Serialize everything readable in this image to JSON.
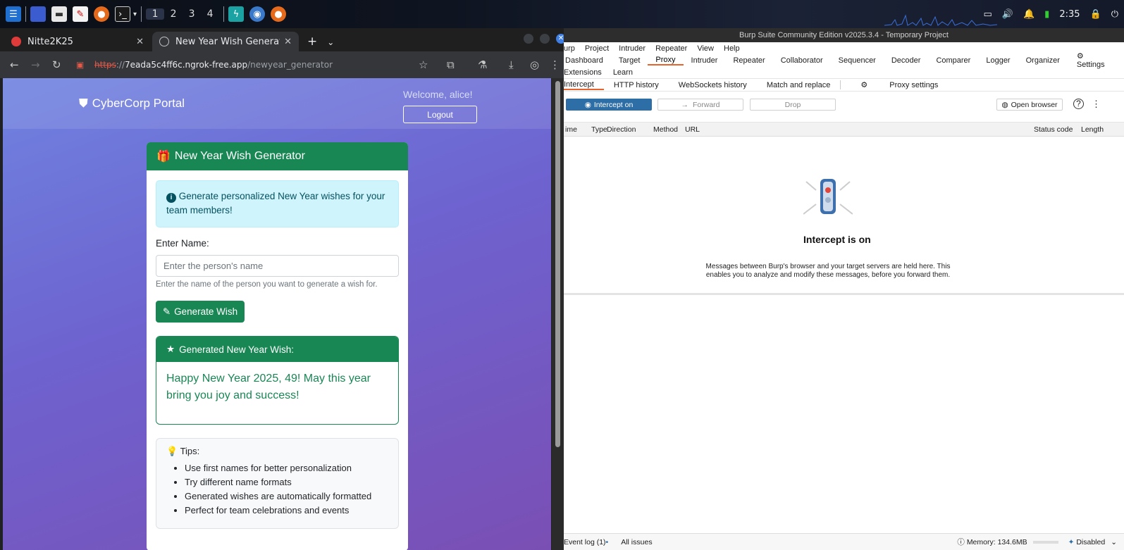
{
  "taskbar": {
    "workspaces": [
      "1",
      "2",
      "3",
      "4"
    ],
    "clock": "2:35"
  },
  "browser": {
    "tabs": [
      {
        "title": "Nitte2K25"
      },
      {
        "title": "New Year Wish Generator"
      }
    ],
    "url_scheme": "https",
    "url_host": "7eada5c4ff6c.ngrok-free.app",
    "url_path": "/newyear_generator"
  },
  "page": {
    "brand": "CyberCorp Portal",
    "welcome": "Welcome, alice!",
    "logout_label": "Logout",
    "card_title": "New Year Wish Generator",
    "info_text": "Generate personalized New Year wishes for your team members!",
    "name_label": "Enter Name:",
    "name_placeholder": "Enter the person's name",
    "help_text": "Enter the name of the person you want to generate a wish for.",
    "generate_label": "Generate Wish",
    "result_title": "Generated New Year Wish:",
    "result_text": "Happy New Year 2025, 49! May this year bring you joy and success!",
    "tips_title": "Tips:",
    "tips": [
      "Use first names for better personalization",
      "Try different name formats",
      "Generated wishes are automatically formatted",
      "Perfect for team celebrations and events"
    ]
  },
  "burp": {
    "title": "Burp Suite Community Edition v2025.3.4 - Temporary Project",
    "menu": [
      "urp",
      "Project",
      "Intruder",
      "Repeater",
      "View",
      "Help"
    ],
    "tabs": [
      "Dashboard",
      "Target",
      "Proxy",
      "Intruder",
      "Repeater",
      "Collaborator",
      "Sequencer",
      "Decoder",
      "Comparer",
      "Logger",
      "Organizer",
      "Settings"
    ],
    "tabs2": [
      "Extensions",
      "Learn"
    ],
    "subtabs": [
      "Intercept",
      "HTTP history",
      "WebSockets history",
      "Match and replace",
      "Proxy settings"
    ],
    "intercept_btn": "Intercept on",
    "forward_btn": "Forward",
    "drop_btn": "Drop",
    "open_browser": "Open browser",
    "columns": [
      "ime",
      "Type",
      "Direction",
      "Method",
      "URL",
      "Status code",
      "Length"
    ],
    "empty_title": "Intercept is on",
    "empty_desc": "Messages between Burp's browser and your target servers are held here. This enables you to analyze and modify these messages, before you forward them.",
    "event_log": "Event log (1)",
    "all_issues": "All issues",
    "memory": "Memory: 134.6MB",
    "disabled": "Disabled"
  },
  "colors": {
    "accent_green": "#198754",
    "burp_orange": "#e8622c",
    "burp_blue": "#2e6ea6"
  }
}
